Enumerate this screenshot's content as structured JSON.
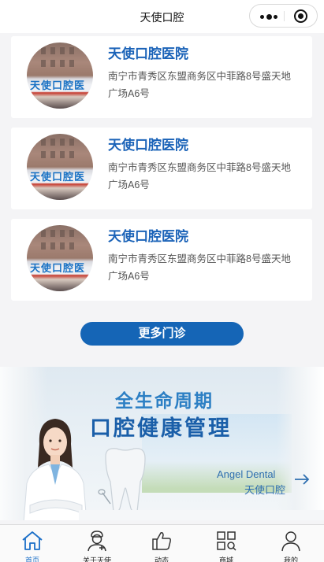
{
  "nav": {
    "title": "天使口腔"
  },
  "clinics": [
    {
      "name": "天使口腔医院",
      "address": "南宁市青秀区东盟商务区中菲路8号盛天地广场A6号",
      "sign": "天使口腔医"
    },
    {
      "name": "天使口腔医院",
      "address": "南宁市青秀区东盟商务区中菲路8号盛天地广场A6号",
      "sign": "天使口腔医"
    },
    {
      "name": "天使口腔医院",
      "address": "南宁市青秀区东盟商务区中菲路8号盛天地广场A6号",
      "sign": "天使口腔医"
    }
  ],
  "more_button": "更多门诊",
  "banner": {
    "line1": "全生命周期",
    "line2": "口腔健康管理",
    "brand_en": "Angel Dental",
    "brand_cn": "天使口腔"
  },
  "tabs": [
    {
      "label": "首页",
      "icon": "home-icon",
      "active": true
    },
    {
      "label": "关于天使",
      "icon": "doctor-icon",
      "active": false
    },
    {
      "label": "动态",
      "icon": "thumbs-up-icon",
      "active": false
    },
    {
      "label": "商城",
      "icon": "grid-search-icon",
      "active": false
    },
    {
      "label": "我的",
      "icon": "user-icon",
      "active": false
    }
  ],
  "colors": {
    "accent": "#1565b6",
    "tab_active": "#1b6fc8",
    "name_blue": "#1b63b8"
  }
}
